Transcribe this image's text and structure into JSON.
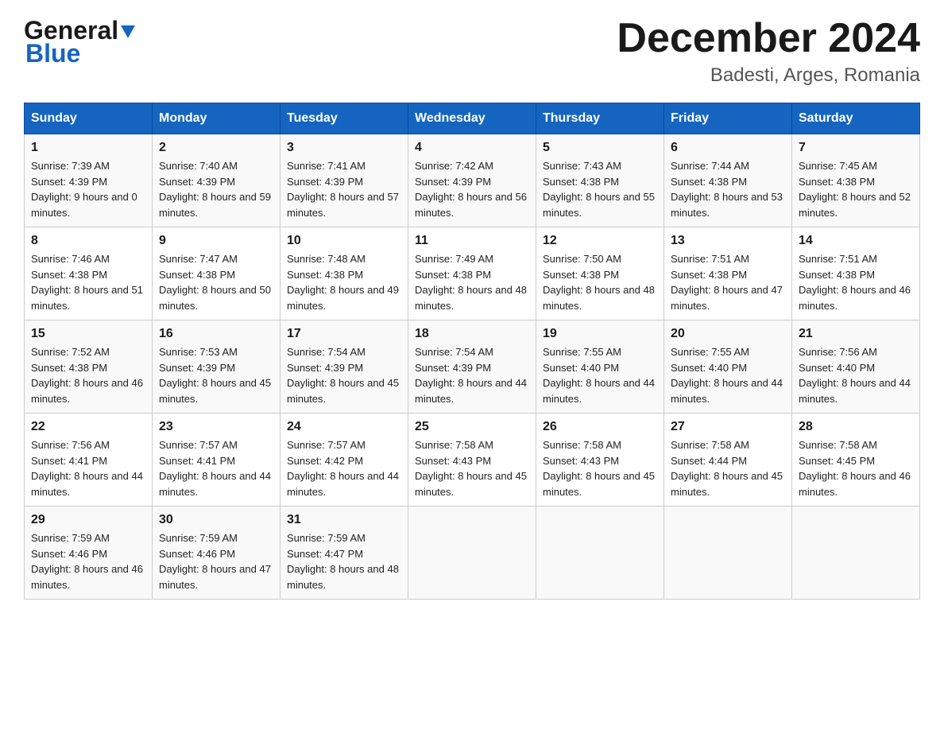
{
  "header": {
    "logo_general": "General",
    "logo_blue": "Blue",
    "month_title": "December 2024",
    "location": "Badesti, Arges, Romania"
  },
  "days_of_week": [
    "Sunday",
    "Monday",
    "Tuesday",
    "Wednesday",
    "Thursday",
    "Friday",
    "Saturday"
  ],
  "weeks": [
    [
      {
        "day": "1",
        "sunrise": "7:39 AM",
        "sunset": "4:39 PM",
        "daylight": "9 hours and 0 minutes."
      },
      {
        "day": "2",
        "sunrise": "7:40 AM",
        "sunset": "4:39 PM",
        "daylight": "8 hours and 59 minutes."
      },
      {
        "day": "3",
        "sunrise": "7:41 AM",
        "sunset": "4:39 PM",
        "daylight": "8 hours and 57 minutes."
      },
      {
        "day": "4",
        "sunrise": "7:42 AM",
        "sunset": "4:39 PM",
        "daylight": "8 hours and 56 minutes."
      },
      {
        "day": "5",
        "sunrise": "7:43 AM",
        "sunset": "4:38 PM",
        "daylight": "8 hours and 55 minutes."
      },
      {
        "day": "6",
        "sunrise": "7:44 AM",
        "sunset": "4:38 PM",
        "daylight": "8 hours and 53 minutes."
      },
      {
        "day": "7",
        "sunrise": "7:45 AM",
        "sunset": "4:38 PM",
        "daylight": "8 hours and 52 minutes."
      }
    ],
    [
      {
        "day": "8",
        "sunrise": "7:46 AM",
        "sunset": "4:38 PM",
        "daylight": "8 hours and 51 minutes."
      },
      {
        "day": "9",
        "sunrise": "7:47 AM",
        "sunset": "4:38 PM",
        "daylight": "8 hours and 50 minutes."
      },
      {
        "day": "10",
        "sunrise": "7:48 AM",
        "sunset": "4:38 PM",
        "daylight": "8 hours and 49 minutes."
      },
      {
        "day": "11",
        "sunrise": "7:49 AM",
        "sunset": "4:38 PM",
        "daylight": "8 hours and 48 minutes."
      },
      {
        "day": "12",
        "sunrise": "7:50 AM",
        "sunset": "4:38 PM",
        "daylight": "8 hours and 48 minutes."
      },
      {
        "day": "13",
        "sunrise": "7:51 AM",
        "sunset": "4:38 PM",
        "daylight": "8 hours and 47 minutes."
      },
      {
        "day": "14",
        "sunrise": "7:51 AM",
        "sunset": "4:38 PM",
        "daylight": "8 hours and 46 minutes."
      }
    ],
    [
      {
        "day": "15",
        "sunrise": "7:52 AM",
        "sunset": "4:38 PM",
        "daylight": "8 hours and 46 minutes."
      },
      {
        "day": "16",
        "sunrise": "7:53 AM",
        "sunset": "4:39 PM",
        "daylight": "8 hours and 45 minutes."
      },
      {
        "day": "17",
        "sunrise": "7:54 AM",
        "sunset": "4:39 PM",
        "daylight": "8 hours and 45 minutes."
      },
      {
        "day": "18",
        "sunrise": "7:54 AM",
        "sunset": "4:39 PM",
        "daylight": "8 hours and 44 minutes."
      },
      {
        "day": "19",
        "sunrise": "7:55 AM",
        "sunset": "4:40 PM",
        "daylight": "8 hours and 44 minutes."
      },
      {
        "day": "20",
        "sunrise": "7:55 AM",
        "sunset": "4:40 PM",
        "daylight": "8 hours and 44 minutes."
      },
      {
        "day": "21",
        "sunrise": "7:56 AM",
        "sunset": "4:40 PM",
        "daylight": "8 hours and 44 minutes."
      }
    ],
    [
      {
        "day": "22",
        "sunrise": "7:56 AM",
        "sunset": "4:41 PM",
        "daylight": "8 hours and 44 minutes."
      },
      {
        "day": "23",
        "sunrise": "7:57 AM",
        "sunset": "4:41 PM",
        "daylight": "8 hours and 44 minutes."
      },
      {
        "day": "24",
        "sunrise": "7:57 AM",
        "sunset": "4:42 PM",
        "daylight": "8 hours and 44 minutes."
      },
      {
        "day": "25",
        "sunrise": "7:58 AM",
        "sunset": "4:43 PM",
        "daylight": "8 hours and 45 minutes."
      },
      {
        "day": "26",
        "sunrise": "7:58 AM",
        "sunset": "4:43 PM",
        "daylight": "8 hours and 45 minutes."
      },
      {
        "day": "27",
        "sunrise": "7:58 AM",
        "sunset": "4:44 PM",
        "daylight": "8 hours and 45 minutes."
      },
      {
        "day": "28",
        "sunrise": "7:58 AM",
        "sunset": "4:45 PM",
        "daylight": "8 hours and 46 minutes."
      }
    ],
    [
      {
        "day": "29",
        "sunrise": "7:59 AM",
        "sunset": "4:46 PM",
        "daylight": "8 hours and 46 minutes."
      },
      {
        "day": "30",
        "sunrise": "7:59 AM",
        "sunset": "4:46 PM",
        "daylight": "8 hours and 47 minutes."
      },
      {
        "day": "31",
        "sunrise": "7:59 AM",
        "sunset": "4:47 PM",
        "daylight": "8 hours and 48 minutes."
      },
      null,
      null,
      null,
      null
    ]
  ],
  "labels": {
    "sunrise": "Sunrise:",
    "sunset": "Sunset:",
    "daylight": "Daylight:"
  }
}
